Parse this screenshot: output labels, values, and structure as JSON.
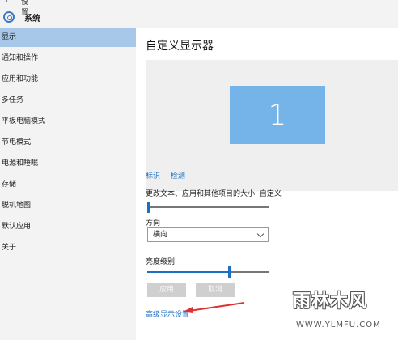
{
  "window": {
    "back_label": "设置",
    "section_title": "系统"
  },
  "sidebar": {
    "items": [
      {
        "label": "显示",
        "selected": true
      },
      {
        "label": "通知和操作"
      },
      {
        "label": "应用和功能"
      },
      {
        "label": "多任务"
      },
      {
        "label": "平板电脑模式"
      },
      {
        "label": "节电模式"
      },
      {
        "label": "电源和睡眠"
      },
      {
        "label": "存储"
      },
      {
        "label": "脱机地图"
      },
      {
        "label": "默认应用"
      },
      {
        "label": "关于"
      }
    ]
  },
  "main": {
    "heading": "自定义显示器",
    "monitor_number": "1",
    "identify_link": "标识",
    "detect_link": "检测",
    "scale_label": "更改文本、应用和其他项目的大小: 自定义",
    "orientation_label": "方向",
    "orientation_value": "横向",
    "brightness_label": "亮度级别",
    "brightness_level": 0.68,
    "apply_button": "应用",
    "cancel_button": "取消",
    "advanced_link": "高级显示设置"
  },
  "watermark": {
    "title": "雨林木风",
    "url": "WWW.YLMFU.COM"
  },
  "colors": {
    "accent": "#1b6fc4",
    "monitor": "#74b4e8",
    "selected": "#a8c8ea",
    "arrow": "#e03030"
  }
}
